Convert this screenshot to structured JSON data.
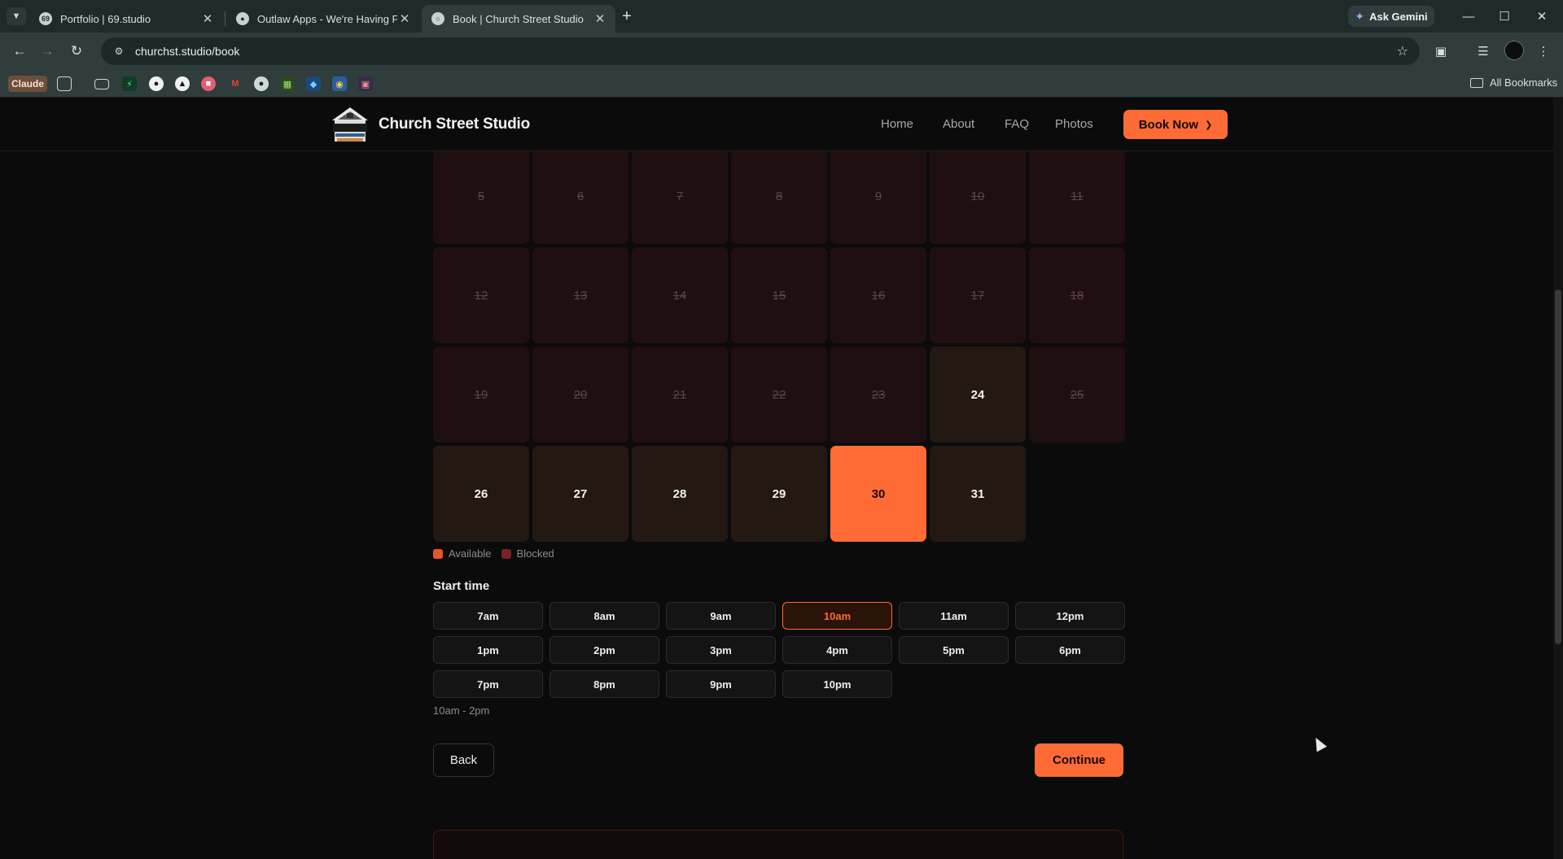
{
  "browser": {
    "tabs": [
      {
        "title": "Portfolio | 69.studio",
        "favicon": "69-icon",
        "active": false
      },
      {
        "title": "Outlaw Apps - We're Having Fu",
        "favicon": "outlaw-icon",
        "active": false
      },
      {
        "title": "Book | Church Street Studio",
        "favicon": "studio-icon",
        "active": true
      }
    ],
    "ask_gemini": "Ask Gemini",
    "url": "churchst.studio/book",
    "bookmarks": {
      "claude": "Claude",
      "all_bookmarks": "All Bookmarks"
    }
  },
  "site": {
    "brand": "Church Street Studio",
    "nav": [
      "Home",
      "About",
      "FAQ",
      "Photos"
    ],
    "book_now": "Book Now"
  },
  "calendar": {
    "weeks": [
      [
        {
          "d": "5",
          "s": "blocked"
        },
        {
          "d": "6",
          "s": "blocked"
        },
        {
          "d": "7",
          "s": "blocked"
        },
        {
          "d": "8",
          "s": "blocked"
        },
        {
          "d": "9",
          "s": "blocked"
        },
        {
          "d": "10",
          "s": "blocked"
        },
        {
          "d": "11",
          "s": "blocked"
        }
      ],
      [
        {
          "d": "12",
          "s": "blocked"
        },
        {
          "d": "13",
          "s": "blocked"
        },
        {
          "d": "14",
          "s": "blocked"
        },
        {
          "d": "15",
          "s": "blocked"
        },
        {
          "d": "16",
          "s": "blocked"
        },
        {
          "d": "17",
          "s": "blocked"
        },
        {
          "d": "18",
          "s": "blocked"
        }
      ],
      [
        {
          "d": "19",
          "s": "blocked"
        },
        {
          "d": "20",
          "s": "blocked"
        },
        {
          "d": "21",
          "s": "blocked"
        },
        {
          "d": "22",
          "s": "blocked"
        },
        {
          "d": "23",
          "s": "blocked"
        },
        {
          "d": "24",
          "s": "available"
        },
        {
          "d": "25",
          "s": "blocked"
        }
      ],
      [
        {
          "d": "26",
          "s": "available"
        },
        {
          "d": "27",
          "s": "available"
        },
        {
          "d": "28",
          "s": "available"
        },
        {
          "d": "29",
          "s": "available"
        },
        {
          "d": "30",
          "s": "selected"
        },
        {
          "d": "31",
          "s": "available"
        }
      ]
    ],
    "legend": {
      "available": "Available",
      "blocked": "Blocked",
      "available_color": "#e8542a",
      "blocked_color": "#7a2326"
    }
  },
  "start_time": {
    "label": "Start time",
    "slots": [
      "7am",
      "8am",
      "9am",
      "10am",
      "11am",
      "12pm",
      "1pm",
      "2pm",
      "3pm",
      "4pm",
      "5pm",
      "6pm",
      "7pm",
      "8pm",
      "9pm",
      "10pm"
    ],
    "selected": "10am",
    "range": "10am - 2pm"
  },
  "actions": {
    "back": "Back",
    "continue": "Continue"
  },
  "colors": {
    "accent": "#ff6b35"
  }
}
